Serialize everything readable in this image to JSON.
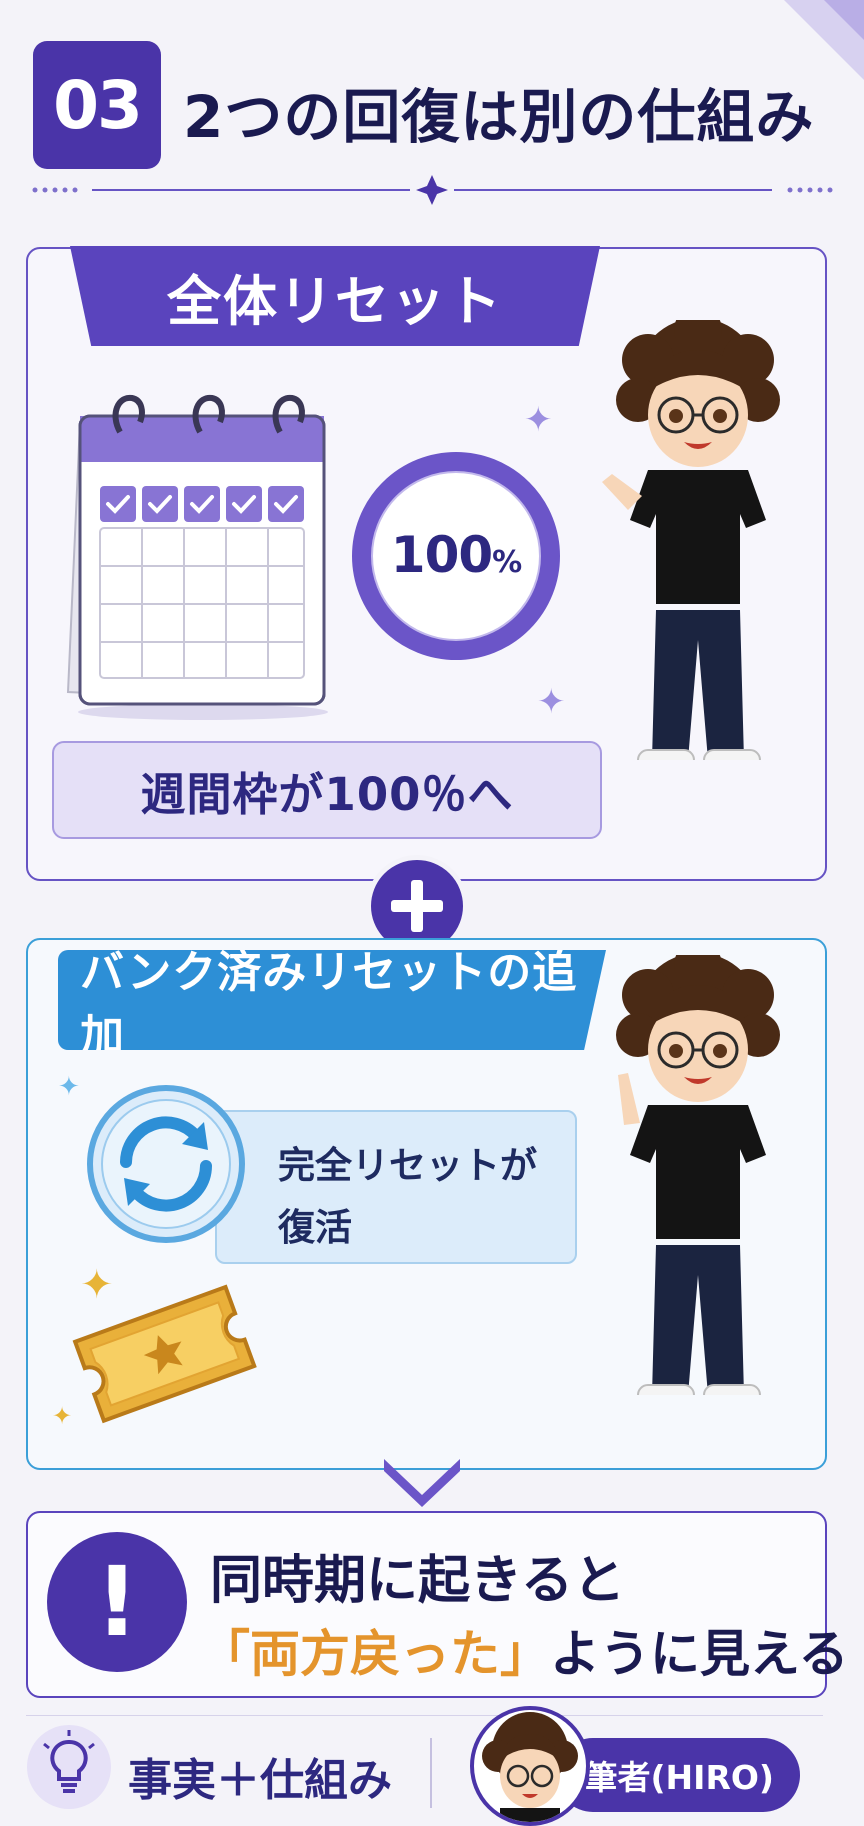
{
  "header": {
    "number": "03",
    "title": "2つの回復は別の仕組み"
  },
  "card1": {
    "ribbon": "全体リセット",
    "ring_value": "100",
    "ring_unit": "%",
    "weekly_label": "週間枠が100％へ"
  },
  "card2": {
    "ribbon": "バンク済みリセットの追加",
    "revive_line1": "完全リセットが",
    "revive_line2": "復活"
  },
  "alert": {
    "line1": "同時期に起きると",
    "line2_highlight": "「両方戻った」",
    "line2_rest": "ように見える"
  },
  "footer": {
    "fact_label": "事実＋仕組み",
    "author_label": "筆者(HIRO)"
  },
  "colors": {
    "primary": "#4a34a8",
    "blue": "#2d8fd6",
    "gold": "#e4942c"
  },
  "icons": [
    "calendar-icon",
    "sync-icon",
    "ticket-icon",
    "alert-icon",
    "bulb-icon",
    "plus-icon",
    "chevron-down-icon"
  ]
}
